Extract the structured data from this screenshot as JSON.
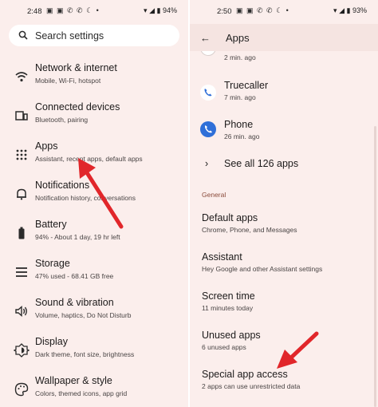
{
  "left": {
    "status": {
      "time": "2:48",
      "notifs": "▣ ▣ ✆ ✆ ☾ •",
      "battery": "94%"
    },
    "search": {
      "placeholder": "Search settings"
    },
    "items": [
      {
        "title": "Network & internet",
        "subtitle": "Mobile, Wi-Fi, hotspot",
        "icon": "wifi-icon"
      },
      {
        "title": "Connected devices",
        "subtitle": "Bluetooth, pairing",
        "icon": "devices-icon"
      },
      {
        "title": "Apps",
        "subtitle": "Assistant, recent apps, default apps",
        "icon": "apps-grid-icon"
      },
      {
        "title": "Notifications",
        "subtitle": "Notification history, conversations",
        "icon": "bell-icon"
      },
      {
        "title": "Battery",
        "subtitle": "94% - About 1 day, 19 hr left",
        "icon": "battery-icon"
      },
      {
        "title": "Storage",
        "subtitle": "47% used - 68.41 GB free",
        "icon": "storage-icon"
      },
      {
        "title": "Sound & vibration",
        "subtitle": "Volume, haptics, Do Not Disturb",
        "icon": "volume-icon"
      },
      {
        "title": "Display",
        "subtitle": "Dark theme, font size, brightness",
        "icon": "brightness-icon"
      },
      {
        "title": "Wallpaper & style",
        "subtitle": "Colors, themed icons, app grid",
        "icon": "palette-icon"
      }
    ]
  },
  "right": {
    "status": {
      "time": "2:50",
      "notifs": "▣ ▣ ✆ ✆ ☾ •",
      "battery": "93%"
    },
    "appbar": {
      "title": "Apps",
      "back_icon": "arrow-back-icon"
    },
    "recent": [
      {
        "title": "",
        "subtitle": "2 min. ago"
      },
      {
        "title": "Truecaller",
        "subtitle": "7 min. ago"
      },
      {
        "title": "Phone",
        "subtitle": "26 min. ago"
      }
    ],
    "see_all": "See all 126 apps",
    "section_label": "General",
    "items": [
      {
        "title": "Default apps",
        "subtitle": "Chrome, Phone, and Messages"
      },
      {
        "title": "Assistant",
        "subtitle": "Hey Google and other Assistant settings"
      },
      {
        "title": "Screen time",
        "subtitle": "11 minutes today"
      },
      {
        "title": "Unused apps",
        "subtitle": "6 unused apps"
      },
      {
        "title": "Special app access",
        "subtitle": "2 apps can use unrestricted data"
      }
    ]
  },
  "colors": {
    "panel_bg": "#fbeeec",
    "arrow": "#e1262a",
    "accent_blue": "#2f6fd8"
  }
}
